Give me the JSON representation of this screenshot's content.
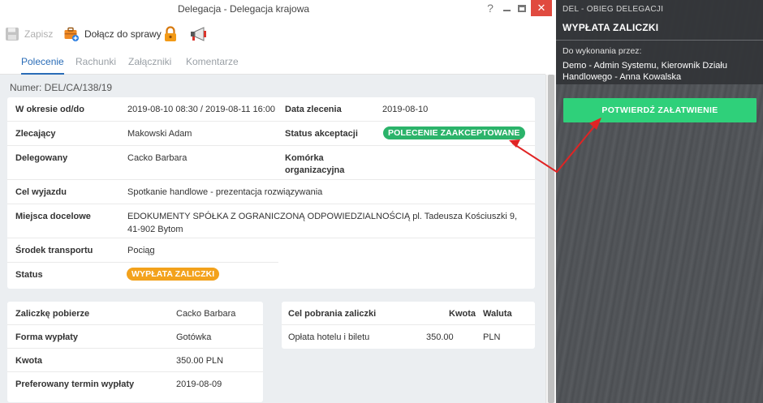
{
  "window": {
    "title": "Delegacja - Delegacja krajowa",
    "help_glyph": "?",
    "close_glyph": "✕"
  },
  "toolbar": {
    "save_label": "Zapisz",
    "join_label": "Dołącz do sprawy"
  },
  "tabs": [
    {
      "label": "Polecenie",
      "active": true
    },
    {
      "label": "Rachunki",
      "active": false
    },
    {
      "label": "Załączniki",
      "active": false
    },
    {
      "label": "Komentarze",
      "active": false
    }
  ],
  "document": {
    "number": "Numer: DEL/CA/138/19",
    "period_label": "W okresie od/do",
    "period_value": "2019-08-10 08:30 / 2019-08-11 16:00",
    "order_date_label": "Data zlecenia",
    "order_date_value": "2019-08-10",
    "requester_label": "Zlecający",
    "requester_value": "Makowski Adam",
    "acceptance_label": "Status akceptacji",
    "acceptance_value": "POLECENIE ZAAKCEPTOWANE",
    "delegate_label": "Delegowany",
    "delegate_value": "Cacko Barbara",
    "unit_label": "Komórka organizacyjna",
    "unit_value": "",
    "purpose_label": "Cel wyjazdu",
    "purpose_value": "Spotkanie handlowe - prezentacja rozwiązywania",
    "destination_label": "Miejsca docelowe",
    "destination_value": "EDOKUMENTY SPÓŁKA Z OGRANICZONĄ ODPOWIEDZIALNOŚCIĄ pl. Tadeusza Kościuszki 9, 41-902 Bytom",
    "transport_label": "Środek transportu",
    "transport_value": "Pociąg",
    "status_label": "Status",
    "status_value": "WYPŁATA ZALICZKI",
    "colors": {
      "accepted": "#2bb36a",
      "status": "#f3a21c",
      "accent": "#2a6cb7"
    }
  },
  "advance": {
    "receiver_label": "Zaliczkę pobierze",
    "receiver_value": "Cacko Barbara",
    "payment_form_label": "Forma wypłaty",
    "payment_form_value": "Gotówka",
    "amount_label": "Kwota",
    "amount_value": "350.00 PLN",
    "preferred_date_label": "Preferowany termin wypłaty",
    "preferred_date_value": "2019-08-09"
  },
  "advance_purpose": {
    "columns": [
      "Cel pobrania zaliczki",
      "Kwota",
      "Waluta"
    ],
    "rows": [
      [
        "Opłata hotelu i biletu",
        "350.00",
        "PLN"
      ]
    ]
  },
  "panel": {
    "module": "DEL - OBIEG DELEGACJI",
    "title": "WYPŁATA ZALICZKI",
    "assignee_label": "Do wykonania przez:",
    "assignee": "Demo - Admin Systemu, Kierownik Działu Handlowego - Anna Kowalska",
    "confirm_button": "POTWIERDŹ ZAŁATWIENIE",
    "confirm_color": "#2fd07a"
  }
}
